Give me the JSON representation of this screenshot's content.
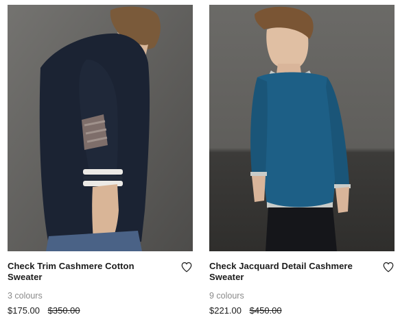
{
  "products": [
    {
      "title": "Check Trim Cashmere Cotton Sweater",
      "colours": "3 colours",
      "price": "$175.00",
      "original_price": "$350.00",
      "photo_alt": "Model wearing navy sweater with check trim cuff",
      "icon": "heart-outline-icon"
    },
    {
      "title": "Check Jacquard Detail Cashmere Sweater",
      "colours": "9 colours",
      "price": "$221.00",
      "original_price": "$450.00",
      "photo_alt": "Model wearing teal blue crew neck sweater",
      "icon": "heart-outline-icon"
    }
  ],
  "colors": {
    "navy": "#1b2333",
    "teal": "#1d5f86",
    "background_left": "#6a6966",
    "background_right": "#4f4e4c"
  }
}
